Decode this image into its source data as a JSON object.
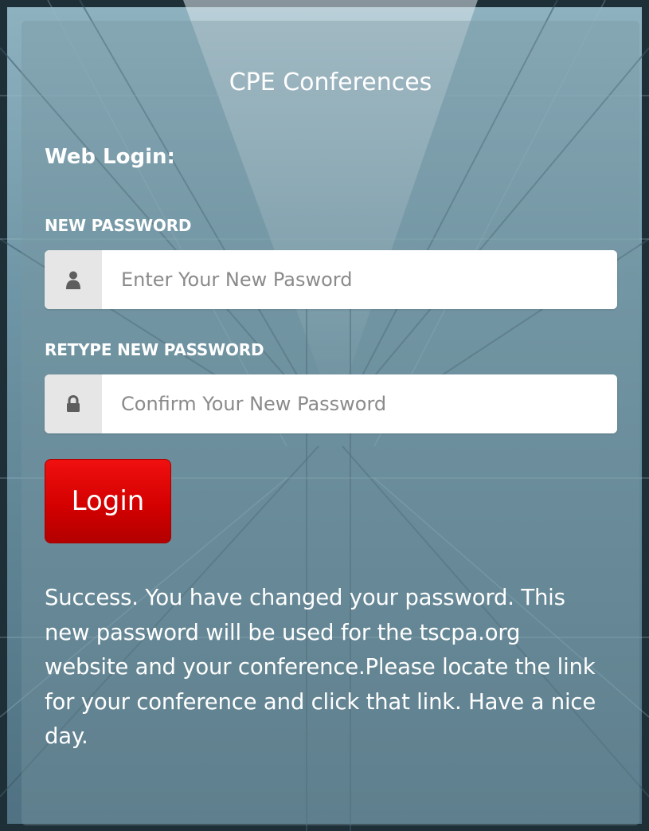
{
  "card": {
    "title": "CPE Conferences",
    "section_heading": "Web Login:"
  },
  "new_password": {
    "label": "NEW PASSWORD",
    "placeholder": "Enter Your New Pasword",
    "value": "",
    "icon": "user-icon"
  },
  "retype_password": {
    "label": "RETYPE NEW PASSWORD",
    "placeholder": "Confirm Your New Password",
    "value": "",
    "icon": "lock-icon"
  },
  "login_button": {
    "label": "Login",
    "color": "#d40000"
  },
  "message": {
    "text": "Success. You have changed your password. This new password will be used for the tscpa.org website and your conference.Please locate the link for your conference and click that link. Have a nice day."
  }
}
